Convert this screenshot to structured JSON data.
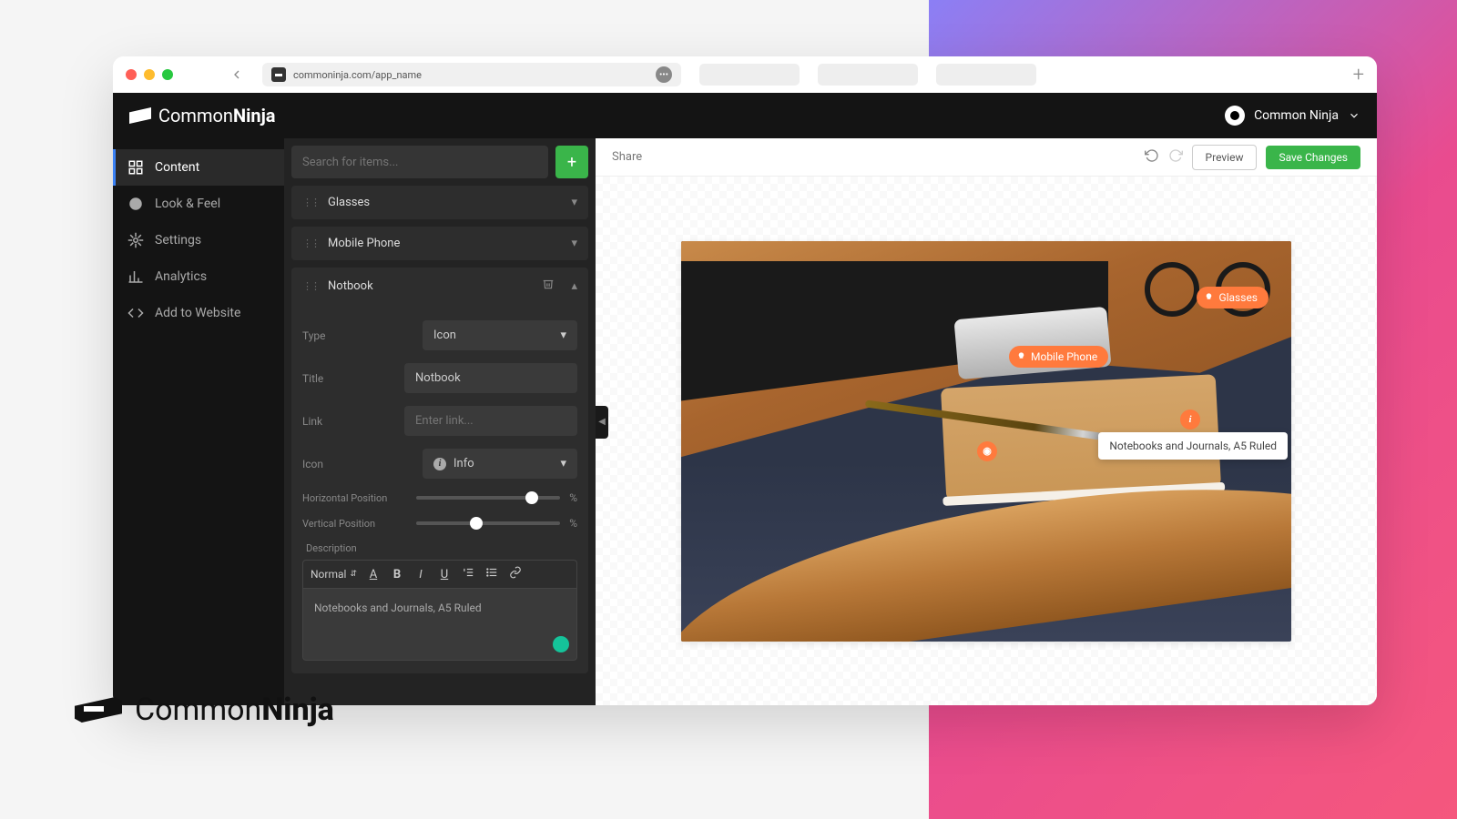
{
  "url": "commoninja.com/app_name",
  "brand": {
    "common": "Common",
    "ninja": "Ninja"
  },
  "user": {
    "name": "Common Ninja"
  },
  "sidebar": {
    "items": [
      {
        "label": "Content"
      },
      {
        "label": "Look & Feel"
      },
      {
        "label": "Settings"
      },
      {
        "label": "Analytics"
      },
      {
        "label": "Add to Website"
      }
    ]
  },
  "panel": {
    "search_placeholder": "Search for items...",
    "items": [
      {
        "title": "Glasses"
      },
      {
        "title": "Mobile Phone"
      },
      {
        "title": "Notbook"
      }
    ],
    "form": {
      "type_label": "Type",
      "type_value": "Icon",
      "title_label": "Title",
      "title_value": "Notbook",
      "link_label": "Link",
      "link_placeholder": "Enter link...",
      "icon_label": "Icon",
      "icon_value": "Info",
      "hpos_label": "Horizontal Position",
      "hpos_value": 80,
      "vpos_label": "Vertical Position",
      "vpos_value": 42,
      "percent": "%",
      "desc_label": "Description",
      "format_value": "Normal",
      "desc_text": "Notebooks and Journals, A5 Ruled"
    }
  },
  "preview": {
    "share": "Share",
    "preview_btn": "Preview",
    "save_btn": "Save Changes",
    "hotspots": {
      "glasses": "Glasses",
      "phone": "Mobile Phone",
      "tooltip": "Notebooks and Journals, A5 Ruled"
    }
  }
}
